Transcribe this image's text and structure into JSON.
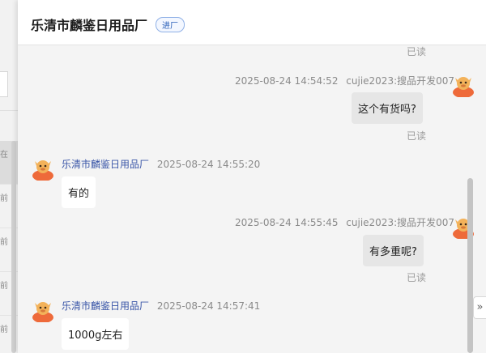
{
  "background_list": {
    "rows": [
      "在",
      "前",
      "前",
      "前",
      "前"
    ]
  },
  "header": {
    "title": "乐清市麟鉴日用品厂",
    "badge": "进厂"
  },
  "messages": [
    {
      "read": "已读"
    },
    {
      "time": "2025-08-24 14:54:52",
      "sender": "cujie2023:搜品开发007",
      "text": "这个有货吗?",
      "read": "已读"
    },
    {
      "time": "2025-08-24 14:55:20",
      "sender": "乐清市麟鉴日用品厂",
      "text": "有的"
    },
    {
      "time": "2025-08-24 14:55:45",
      "sender": "cujie2023:搜品开发007",
      "text": "有多重呢?",
      "read": "已读"
    },
    {
      "time": "2025-08-24 14:57:41",
      "sender": "乐清市麟鉴日用品厂",
      "text": "1000g左右"
    }
  ],
  "collapse_button": "»",
  "colors": {
    "accent": "#2a5fb8",
    "avatar_orange": "#ee6a3a"
  }
}
